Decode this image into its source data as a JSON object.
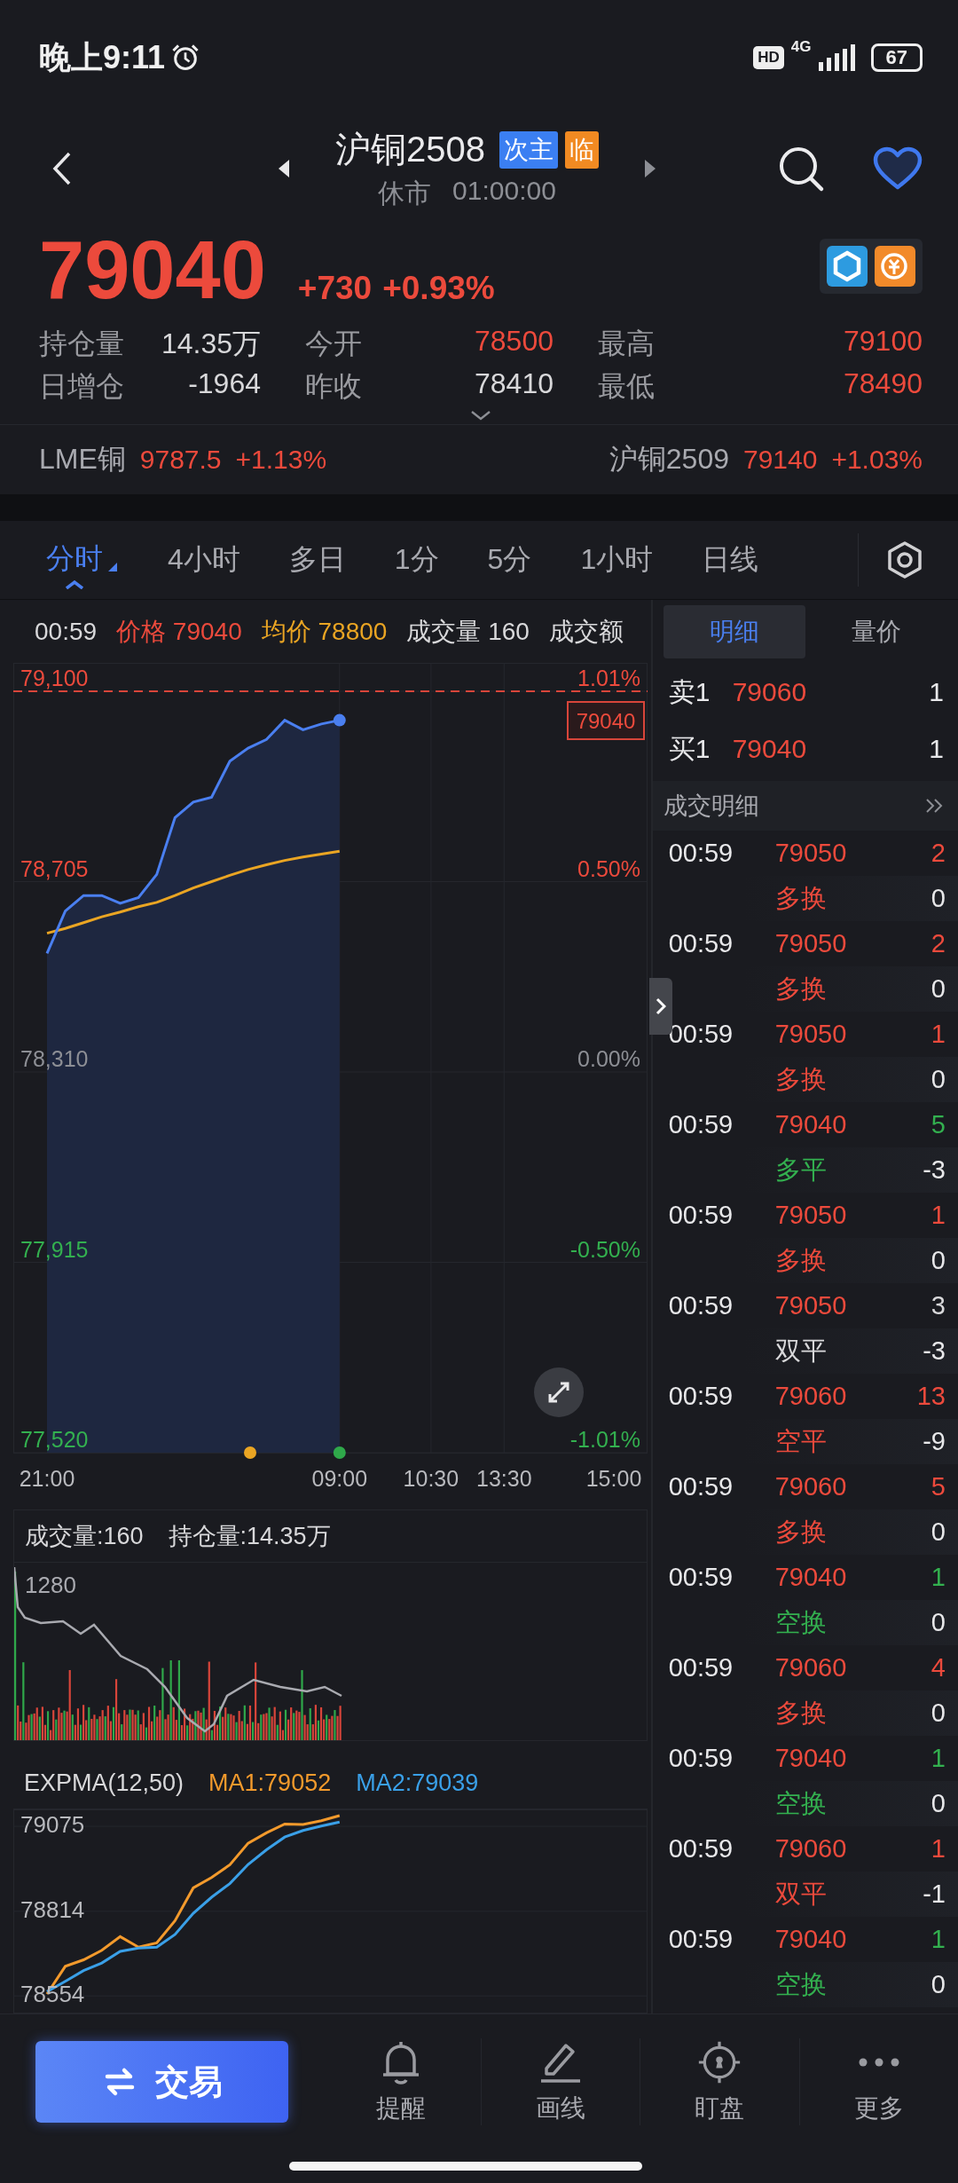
{
  "status_bar": {
    "time": "晚上9:11",
    "hd": "HD",
    "network": "4G",
    "battery": "67"
  },
  "header": {
    "title": "沪铜2508",
    "badges": [
      {
        "label": "次主",
        "color": "#3b7ff2"
      },
      {
        "label": "临",
        "color": "#f18a22"
      }
    ],
    "market_status": "休市",
    "countdown": "01:00:00"
  },
  "quote": {
    "price": "79040",
    "change": "+730",
    "change_pct": "+0.93%",
    "stats": [
      {
        "label": "持仓量",
        "value": "14.35万",
        "color": "#d8d8da"
      },
      {
        "label": "今开",
        "value": "78500",
        "color": "#ec4a3c"
      },
      {
        "label": "最高",
        "value": "79100",
        "color": "#ec4a3c"
      },
      {
        "label": "日增仓",
        "value": "-1964",
        "color": "#d8d8da"
      },
      {
        "label": "昨收",
        "value": "78410",
        "color": "#d8d8da"
      },
      {
        "label": "最低",
        "value": "78490",
        "color": "#ec4a3c"
      }
    ]
  },
  "related": [
    {
      "name": "LME铜",
      "price": "9787.5",
      "change_pct": "+1.13%",
      "color": "#ec4a3c"
    },
    {
      "name": "沪铜2509",
      "price": "79140",
      "change_pct": "+1.03%",
      "color": "#ec4a3c"
    }
  ],
  "period_tabs": [
    {
      "label": "分时",
      "selected": true
    },
    {
      "label": "4小时",
      "selected": false
    },
    {
      "label": "多日",
      "selected": false
    },
    {
      "label": "1分",
      "selected": false
    },
    {
      "label": "5分",
      "selected": false
    },
    {
      "label": "1小时",
      "selected": false
    },
    {
      "label": "日线",
      "selected": false
    }
  ],
  "chart_header": [
    {
      "label": "00:59",
      "color": "#d8d8da"
    },
    {
      "label": "价格 79040",
      "color": "#ec4a3c"
    },
    {
      "label": "均价 78800",
      "color": "#eaa523"
    },
    {
      "label": "成交量 160",
      "color": "#d8d8da"
    },
    {
      "label": "成交额",
      "color": "#d8d8da"
    }
  ],
  "price_chart": {
    "current_price_tag": "79040",
    "right_axis_labels": [
      {
        "label": "1.01%",
        "color": "#ec4a3c"
      },
      {
        "label": "0.50%",
        "color": "#ec4a3c"
      },
      {
        "label": "0.00%",
        "color": "#8d8f95"
      },
      {
        "label": "-0.50%",
        "color": "#33b04f"
      },
      {
        "label": "-1.01%",
        "color": "#33b04f"
      }
    ],
    "chart_data": {
      "type": "line",
      "grid": true,
      "categories": [
        "21:00",
        null,
        null,
        null,
        null,
        null,
        null,
        null,
        null,
        null,
        null,
        null,
        null,
        null,
        null,
        null,
        "09:00",
        null,
        null,
        null,
        null,
        "10:30",
        null,
        null,
        null,
        "13:30",
        null,
        null,
        null,
        null,
        null,
        "15:00"
      ],
      "series": [
        {
          "color": "#4a7ff0",
          "values": [
            78556,
            78644,
            78676,
            78676,
            78660,
            78672,
            78720,
            78838,
            78870,
            78880,
            78955,
            78982,
            79000,
            79040,
            79020,
            79032,
            79040,
            null,
            null,
            null,
            null,
            null,
            null,
            null,
            null,
            null,
            null,
            null,
            null,
            null,
            null,
            null
          ]
        },
        {
          "color": "#eaa523",
          "values": [
            78598,
            78608,
            78620,
            78632,
            78642,
            78653,
            78662,
            78676,
            78692,
            78705,
            78718,
            78730,
            78740,
            78749,
            78756,
            78762,
            78768,
            null,
            null,
            null,
            null,
            null,
            null,
            null,
            null,
            null,
            null,
            null,
            null,
            null,
            null,
            null
          ]
        }
      ],
      "ylim": [
        77520,
        79100
      ],
      "yticks": [
        {
          "value": 79100,
          "label": "79,100"
        },
        {
          "value": 78705,
          "label": "78,705"
        },
        {
          "value": 78310,
          "label": "78,310"
        },
        {
          "value": 77915,
          "label": "77,915"
        },
        {
          "value": 77520,
          "label": "77,520"
        }
      ]
    }
  },
  "volume_panel": {
    "volume": "成交量:160",
    "open_interest": "持仓量:14.35万",
    "axis_label": "1280"
  },
  "expma_panel": {
    "title": "EXPMA(12,50)",
    "ma1": "MA1:79052",
    "ma2": "MA2:79039",
    "chart_data": {
      "type": "line",
      "grid": true,
      "categories": [
        null,
        null,
        null,
        null,
        null,
        null,
        null,
        null,
        null,
        null,
        null,
        null,
        null,
        null,
        null,
        null,
        null,
        null,
        null,
        null,
        null,
        null,
        null,
        null,
        null,
        null,
        null,
        null,
        null,
        null,
        null,
        null
      ],
      "series": [
        {
          "color": "#f39a2c",
          "values": [
            78560,
            78645,
            78665,
            78694,
            78736,
            78704,
            78717,
            78785,
            78886,
            78918,
            78957,
            79023,
            79055,
            79082,
            79081,
            79092,
            79108,
            null,
            null,
            null,
            null,
            null,
            null,
            null,
            null,
            null,
            null,
            null,
            null,
            null,
            null,
            null
          ]
        },
        {
          "color": "#3aa0e8",
          "values": [
            78567,
            78599,
            78632,
            78655,
            78691,
            78701,
            78704,
            78743,
            78808,
            78857,
            78899,
            78958,
            79003,
            79042,
            79062,
            79076,
            79088,
            null,
            null,
            null,
            null,
            null,
            null,
            null,
            null,
            null,
            null,
            null,
            null,
            null,
            null,
            null
          ]
        }
      ],
      "ylim": [
        78500,
        79127
      ],
      "yticks": [
        {
          "value": 79075,
          "label": "79075"
        },
        {
          "value": 78814,
          "label": "78814"
        },
        {
          "value": 78554,
          "label": "78554"
        }
      ]
    }
  },
  "side_panel": {
    "tabs": [
      {
        "label": "明细",
        "selected": true
      },
      {
        "label": "量价",
        "selected": false
      }
    ],
    "order_book": [
      {
        "label": "卖1",
        "price": "79060",
        "volume": "1"
      },
      {
        "label": "买1",
        "price": "79040",
        "volume": "1"
      }
    ],
    "trades_title": "成交明细",
    "trades": [
      {
        "time": "00:59",
        "price": "79050",
        "volume": {
          "text": "2",
          "color": "#ec4a3c"
        },
        "type": {
          "text": "多换",
          "color": "#ec4a3c"
        },
        "change": "0"
      },
      {
        "time": "00:59",
        "price": "79050",
        "volume": {
          "text": "2",
          "color": "#ec4a3c"
        },
        "type": {
          "text": "多换",
          "color": "#ec4a3c"
        },
        "change": "0"
      },
      {
        "time": "00:59",
        "price": "79050",
        "volume": {
          "text": "1",
          "color": "#ec4a3c"
        },
        "type": {
          "text": "多换",
          "color": "#ec4a3c"
        },
        "change": "0"
      },
      {
        "time": "00:59",
        "price": "79040",
        "volume": {
          "text": "5",
          "color": "#33b04f"
        },
        "type": {
          "text": "多平",
          "color": "#33b04f"
        },
        "change": "-3"
      },
      {
        "time": "00:59",
        "price": "79050",
        "volume": {
          "text": "1",
          "color": "#ec4a3c"
        },
        "type": {
          "text": "多换",
          "color": "#ec4a3c"
        },
        "change": "0"
      },
      {
        "time": "00:59",
        "price": "79050",
        "volume": {
          "text": "3",
          "color": "#d8d8da"
        },
        "type": {
          "text": "双平",
          "color": "#d8d8da"
        },
        "change": "-3"
      },
      {
        "time": "00:59",
        "price": "79060",
        "volume": {
          "text": "13",
          "color": "#ec4a3c"
        },
        "type": {
          "text": "空平",
          "color": "#ec4a3c"
        },
        "change": "-9"
      },
      {
        "time": "00:59",
        "price": "79060",
        "volume": {
          "text": "5",
          "color": "#ec4a3c"
        },
        "type": {
          "text": "多换",
          "color": "#ec4a3c"
        },
        "change": "0"
      },
      {
        "time": "00:59",
        "price": "79040",
        "volume": {
          "text": "1",
          "color": "#33b04f"
        },
        "type": {
          "text": "空换",
          "color": "#33b04f"
        },
        "change": "0"
      },
      {
        "time": "00:59",
        "price": "79060",
        "volume": {
          "text": "4",
          "color": "#ec4a3c"
        },
        "type": {
          "text": "多换",
          "color": "#ec4a3c"
        },
        "change": "0"
      },
      {
        "time": "00:59",
        "price": "79040",
        "volume": {
          "text": "1",
          "color": "#33b04f"
        },
        "type": {
          "text": "空换",
          "color": "#33b04f"
        },
        "change": "0"
      },
      {
        "time": "00:59",
        "price": "79060",
        "volume": {
          "text": "1",
          "color": "#ec4a3c"
        },
        "type": {
          "text": "双平",
          "color": "#ec4a3c"
        },
        "change": "-1"
      },
      {
        "time": "00:59",
        "price": "79040",
        "volume": {
          "text": "1",
          "color": "#33b04f"
        },
        "type": {
          "text": "空换",
          "color": "#33b04f"
        },
        "change": "0"
      }
    ]
  },
  "bottom_bar": {
    "trade_button": "交易",
    "actions": [
      {
        "label": "提醒",
        "kind": "bell"
      },
      {
        "label": "画线",
        "kind": "pencil"
      },
      {
        "label": "盯盘",
        "kind": "target"
      },
      {
        "label": "更多",
        "kind": "more"
      }
    ]
  }
}
